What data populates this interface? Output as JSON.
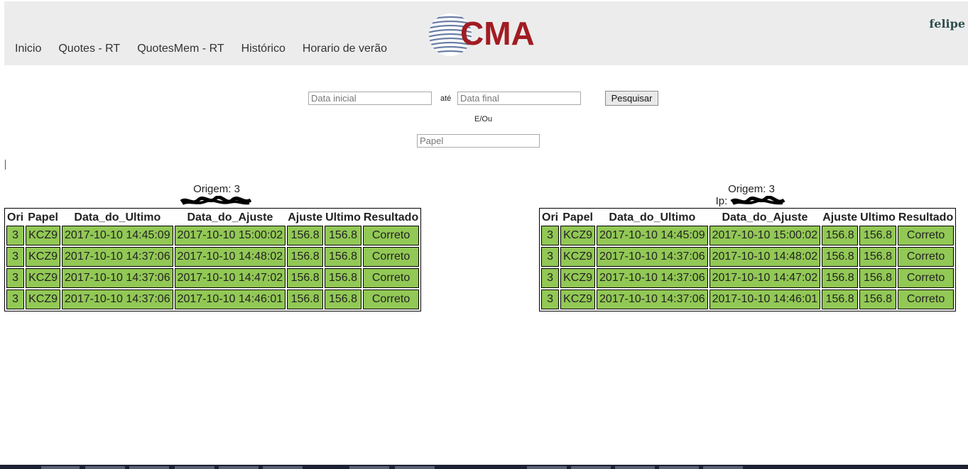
{
  "header": {
    "nav": [
      "Inicio",
      "Quotes - RT",
      "QuotesMem - RT",
      "Histórico",
      "Horario de verão"
    ],
    "logo_text": "CMA",
    "user": "felipe",
    "colors": {
      "bg": "#ececec",
      "logo_red": "#a11c22",
      "logo_globe": "#6b7fa6"
    }
  },
  "search": {
    "start_placeholder": "Data inicial",
    "between": "até",
    "end_placeholder": "Data final",
    "button": "Pesquisar",
    "andor": "E/Ou",
    "paper_placeholder": "Papel"
  },
  "panels": [
    {
      "origin": "Origem: 3",
      "ip_label": "",
      "headers": [
        "Ori",
        "Papel",
        "Data_do_Ultimo",
        "Data_do_Ajuste",
        "Ajuste",
        "Ultimo",
        "Resultado"
      ],
      "rows": [
        [
          "3",
          "KCZ9",
          "2017-10-10 14:45:09",
          "2017-10-10 15:00:02",
          "156.8",
          "156.8",
          "Correto"
        ],
        [
          "3",
          "KCZ9",
          "2017-10-10 14:37:06",
          "2017-10-10 14:48:02",
          "156.8",
          "156.8",
          "Correto"
        ],
        [
          "3",
          "KCZ9",
          "2017-10-10 14:37:06",
          "2017-10-10 14:47:02",
          "156.8",
          "156.8",
          "Correto"
        ],
        [
          "3",
          "KCZ9",
          "2017-10-10 14:37:06",
          "2017-10-10 14:46:01",
          "156.8",
          "156.8",
          "Correto"
        ]
      ]
    },
    {
      "origin": "Origem: 3",
      "ip_label": "Ip:",
      "headers": [
        "Ori",
        "Papel",
        "Data_do_Ultimo",
        "Data_do_Ajuste",
        "Ajuste",
        "Ultimo",
        "Resultado"
      ],
      "rows": [
        [
          "3",
          "KCZ9",
          "2017-10-10 14:45:09",
          "2017-10-10 15:00:02",
          "156.8",
          "156.8",
          "Correto"
        ],
        [
          "3",
          "KCZ9",
          "2017-10-10 14:37:06",
          "2017-10-10 14:48:02",
          "156.8",
          "156.8",
          "Correto"
        ],
        [
          "3",
          "KCZ9",
          "2017-10-10 14:37:06",
          "2017-10-10 14:47:02",
          "156.8",
          "156.8",
          "Correto"
        ],
        [
          "3",
          "KCZ9",
          "2017-10-10 14:37:06",
          "2017-10-10 14:46:01",
          "156.8",
          "156.8",
          "Correto"
        ]
      ]
    }
  ],
  "result_color": "#92c855"
}
